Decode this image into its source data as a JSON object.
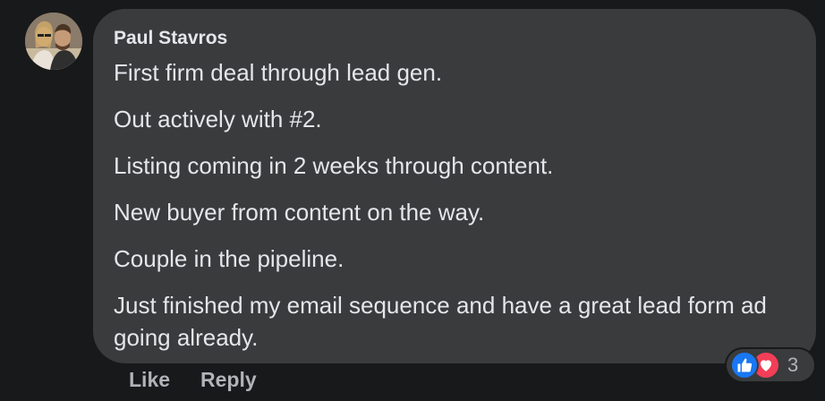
{
  "comment": {
    "author": "Paul Stavros",
    "lines": [
      "First firm deal through lead gen.",
      "Out actively with #2.",
      "Listing coming in 2 weeks through content.",
      "New buyer from content on the way.",
      "Couple in the pipeline.",
      "Just finished my email sequence and have a great lead form ad going already."
    ]
  },
  "actions": {
    "like_label": "Like",
    "reply_label": "Reply"
  },
  "reactions": {
    "count": "3",
    "types": [
      "like-icon",
      "love-icon"
    ]
  },
  "colors": {
    "background": "#18191a",
    "bubble": "#3a3b3c",
    "text": "#e4e6eb",
    "muted": "#b0b3b8",
    "like_blue": "#1877f2",
    "love_red": "#f33e58"
  }
}
